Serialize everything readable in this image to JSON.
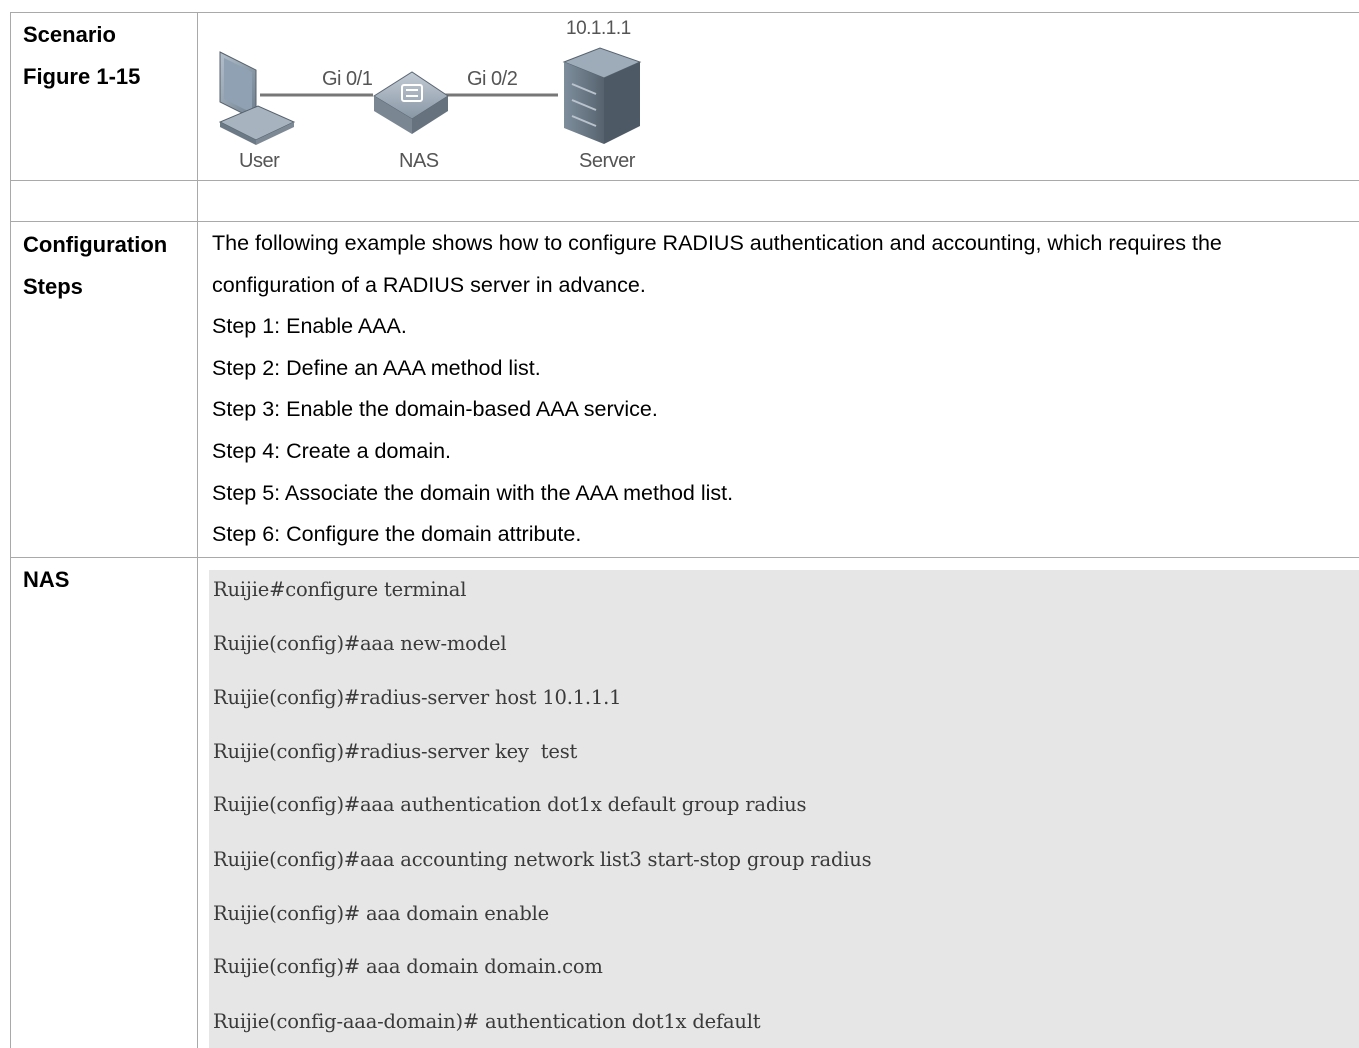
{
  "table": {
    "row_scenario": {
      "label_line1": "Scenario",
      "label_line2": "Figure 1-15"
    },
    "diagram": {
      "server_ip": "10.1.1.1",
      "link_left": "Gi 0/1",
      "link_right": "Gi 0/2",
      "user_label": "User",
      "nas_label": "NAS",
      "server_label": "Server"
    },
    "row_config": {
      "label_line1": "Configuration",
      "label_line2": "Steps",
      "lines": [
        "The following example shows how to configure RADIUS authentication and accounting, which requires the",
        "configuration of a RADIUS server in advance.",
        "Step 1: Enable AAA.",
        "Step 2: Define an AAA method list.",
        "Step 3: Enable the domain-based AAA service.",
        "Step 4: Create a domain.",
        "Step 5: Associate the domain with the AAA method list.",
        "Step 6: Configure the domain attribute."
      ]
    },
    "row_nas": {
      "label": "NAS",
      "code": [
        "Ruijie#configure terminal",
        "Ruijie(config)#aaa new-model",
        "Ruijie(config)#radius-server host 10.1.1.1",
        "Ruijie(config)#radius-server key  test",
        "Ruijie(config)#aaa authentication dot1x default group radius",
        "Ruijie(config)#aaa accounting network list3 start-stop group radius",
        "Ruijie(config)# aaa domain enable",
        "Ruijie(config)# aaa domain domain.com",
        "Ruijie(config-aaa-domain)# authentication dot1x default"
      ]
    }
  },
  "colors": {
    "border": "#a9a9a9",
    "code_bg": "#e6e6e6"
  }
}
